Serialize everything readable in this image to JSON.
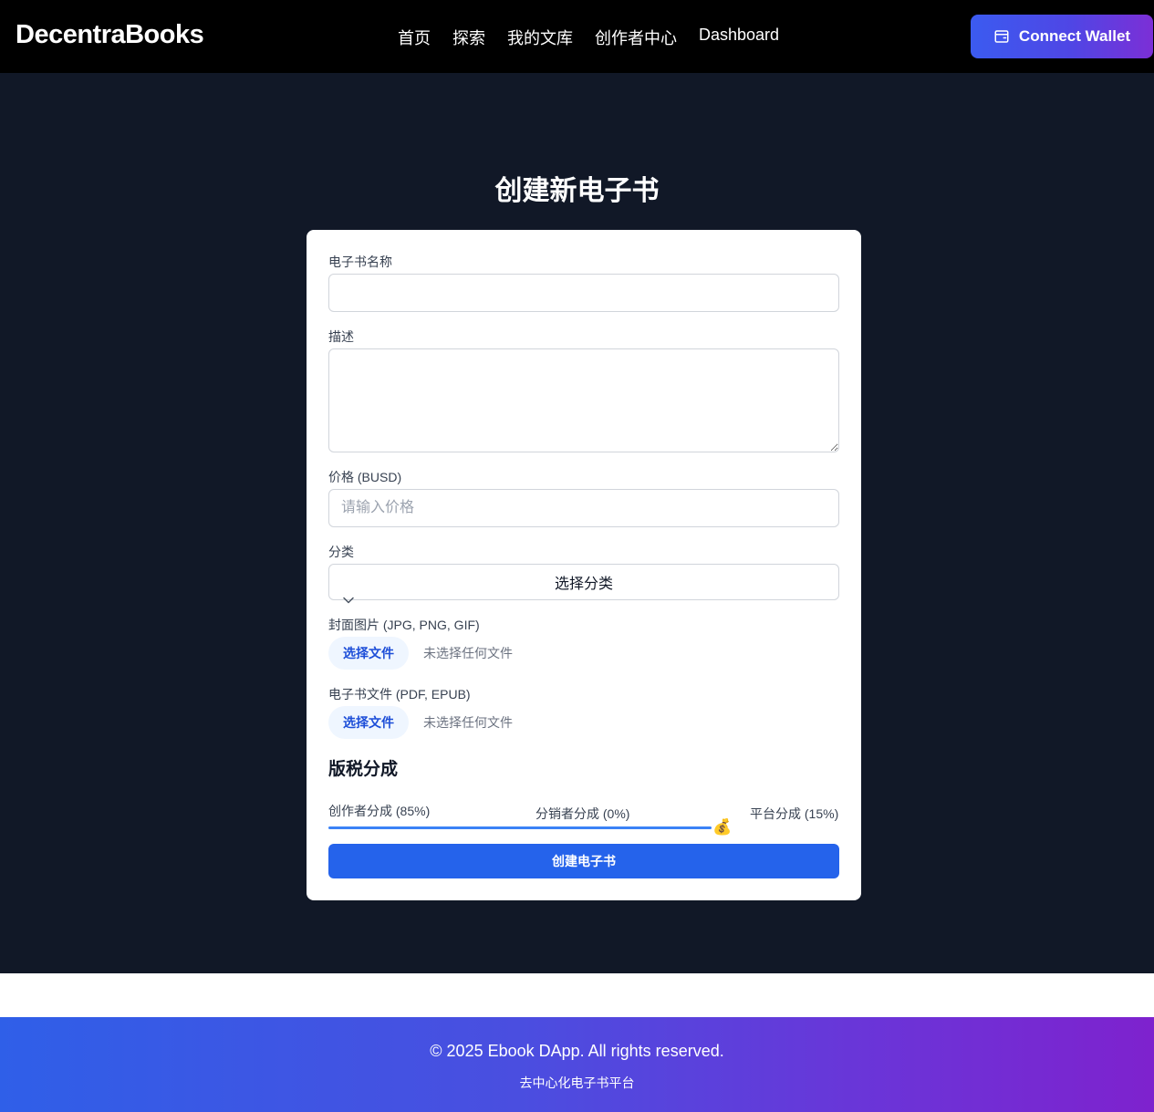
{
  "header": {
    "logo": "DecentraBooks",
    "nav": [
      "首页",
      "探索",
      "我的文库",
      "创作者中心",
      "Dashboard"
    ],
    "wallet_button": "Connect Wallet",
    "wallet_icon": "wallet-icon"
  },
  "page": {
    "title": "创建新电子书"
  },
  "form": {
    "name_label": "电子书名称",
    "name_value": "",
    "description_label": "描述",
    "description_value": "",
    "price_label": "价格 (BUSD)",
    "price_placeholder": "请输入价格",
    "category_label": "分类",
    "category_selected": "选择分类",
    "cover_label": "封面图片 (JPG, PNG, GIF)",
    "cover_button": "选择文件",
    "cover_status": "未选择任何文件",
    "file_label": "电子书文件 (PDF, EPUB)",
    "file_button": "选择文件",
    "file_status": "未选择任何文件",
    "royalty_title": "版税分成",
    "creator_share": "创作者分成 (85%)",
    "distributor_share": "分销者分成 (0%)",
    "platform_share": "平台分成 (15%)",
    "creator_share_value": 85,
    "slider_thumb": "💰",
    "submit_button": "创建电子书",
    "accent_color": "#2563eb"
  },
  "footer": {
    "copyright": "© 2025 Ebook DApp. All rights reserved.",
    "tagline": "去中心化电子书平台"
  }
}
